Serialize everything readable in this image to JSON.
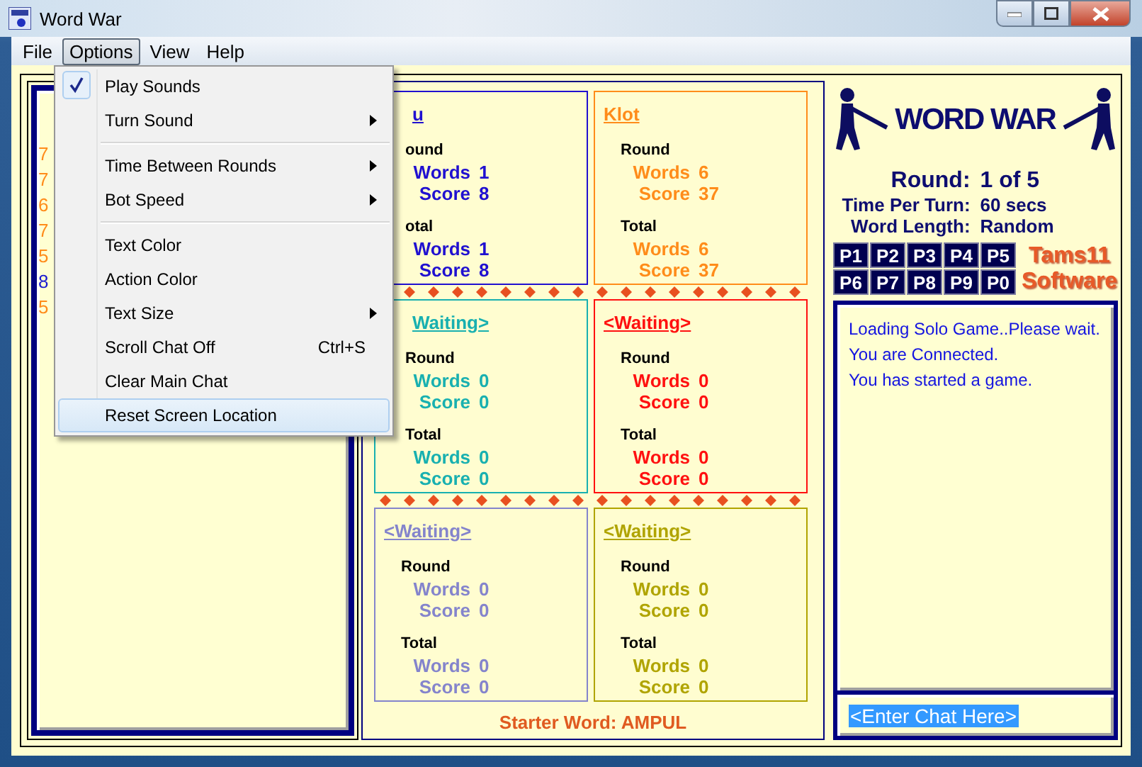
{
  "window": {
    "title": "Word War"
  },
  "menu_bar": [
    {
      "label": "File",
      "selected": false
    },
    {
      "label": "Options",
      "selected": true
    },
    {
      "label": "View",
      "selected": false
    },
    {
      "label": "Help",
      "selected": false
    }
  ],
  "options_menu": [
    {
      "kind": "item",
      "label": "Play Sounds",
      "checked": true,
      "submenu": false,
      "selected": false
    },
    {
      "kind": "item",
      "label": "Turn Sound",
      "checked": false,
      "submenu": true,
      "selected": false
    },
    {
      "kind": "separator"
    },
    {
      "kind": "item",
      "label": "Time Between Rounds",
      "checked": false,
      "submenu": true,
      "selected": false
    },
    {
      "kind": "item",
      "label": "Bot Speed",
      "checked": false,
      "submenu": true,
      "selected": false
    },
    {
      "kind": "separator"
    },
    {
      "kind": "item",
      "label": "Text Color",
      "checked": false,
      "submenu": false,
      "selected": false
    },
    {
      "kind": "item",
      "label": "Action Color",
      "checked": false,
      "submenu": false,
      "selected": false
    },
    {
      "kind": "item",
      "label": "Text Size",
      "checked": false,
      "submenu": true,
      "selected": false
    },
    {
      "kind": "item",
      "label": "Scroll Chat Off",
      "shortcut": "Ctrl+S",
      "checked": false,
      "submenu": false,
      "selected": false
    },
    {
      "kind": "item",
      "label": "Clear Main Chat",
      "checked": false,
      "submenu": false,
      "selected": false
    },
    {
      "kind": "item",
      "label": "Reset Screen Location",
      "checked": false,
      "submenu": false,
      "selected": true
    }
  ],
  "word_list": [
    {
      "text": "7",
      "color": "#ff8c1a"
    },
    {
      "text": "7",
      "color": "#ff8c1a"
    },
    {
      "text": "6",
      "color": "#ff8c1a"
    },
    {
      "text": "7",
      "color": "#ff8c1a"
    },
    {
      "text": "5",
      "color": "#ff8c1a"
    },
    {
      "text": "8",
      "color": "#1a1ad0"
    },
    {
      "text": "5",
      "color": "#ff8c1a"
    }
  ],
  "players": [
    {
      "name": "u",
      "covered": true,
      "color": "#2010d0",
      "round": {
        "label": "ound",
        "rows": [
          {
            "label": "Words",
            "value": "1"
          },
          {
            "label": "Score",
            "value": "8"
          }
        ]
      },
      "total": {
        "label": "otal",
        "rows": [
          {
            "label": "Words",
            "value": "1"
          },
          {
            "label": "Score",
            "value": "8"
          }
        ]
      }
    },
    {
      "name": "Klot",
      "covered": false,
      "color": "#ff8c1a",
      "round": {
        "label": "Round",
        "rows": [
          {
            "label": "Words",
            "value": "6"
          },
          {
            "label": "Score",
            "value": "37"
          }
        ]
      },
      "total": {
        "label": "Total",
        "rows": [
          {
            "label": "Words",
            "value": "6"
          },
          {
            "label": "Score",
            "value": "37"
          }
        ]
      }
    },
    {
      "name": "Waiting>",
      "covered": true,
      "color": "#18b0b0",
      "round": {
        "label": "Round",
        "rows": [
          {
            "label": "Words",
            "value": "0"
          },
          {
            "label": "Score",
            "value": "0"
          }
        ]
      },
      "total": {
        "label": "Total",
        "rows": [
          {
            "label": "Words",
            "value": "0"
          },
          {
            "label": "Score",
            "value": "0"
          }
        ]
      }
    },
    {
      "name": "<Waiting>",
      "covered": false,
      "color": "#ff1010",
      "round": {
        "label": "Round",
        "rows": [
          {
            "label": "Words",
            "value": "0"
          },
          {
            "label": "Score",
            "value": "0"
          }
        ]
      },
      "total": {
        "label": "Total",
        "rows": [
          {
            "label": "Words",
            "value": "0"
          },
          {
            "label": "Score",
            "value": "0"
          }
        ]
      }
    },
    {
      "name": "<Waiting>",
      "covered": false,
      "color": "#8484cc",
      "round": {
        "label": "Round",
        "rows": [
          {
            "label": "Words",
            "value": "0"
          },
          {
            "label": "Score",
            "value": "0"
          }
        ]
      },
      "total": {
        "label": "Total",
        "rows": [
          {
            "label": "Words",
            "value": "0"
          },
          {
            "label": "Score",
            "value": "0"
          }
        ]
      }
    },
    {
      "name": "<Waiting>",
      "covered": false,
      "color": "#b0a400",
      "round": {
        "label": "Round",
        "rows": [
          {
            "label": "Words",
            "value": "0"
          },
          {
            "label": "Score",
            "value": "0"
          }
        ]
      },
      "total": {
        "label": "Total",
        "rows": [
          {
            "label": "Words",
            "value": "0"
          },
          {
            "label": "Score",
            "value": "0"
          }
        ]
      }
    }
  ],
  "starter_word": "Starter Word: AMPUL",
  "logo_text": "WORD WAR",
  "game_info": [
    {
      "label": "Round:",
      "value": "1 of 5",
      "kind": "large"
    },
    {
      "label": "Time Per Turn:",
      "value": "60 secs",
      "kind": "normal"
    },
    {
      "label": "Word Length:",
      "value": "Random",
      "kind": "normal"
    }
  ],
  "player_buttons": [
    "P1",
    "P2",
    "P3",
    "P4",
    "P5",
    "P6",
    "P7",
    "P8",
    "P9",
    "P0"
  ],
  "brand": [
    "Tams11",
    "Software"
  ],
  "chat_log": [
    "Loading Solo Game..Please wait.",
    "You are Connected.",
    "You has started a game."
  ],
  "chat_input": {
    "value": "<Enter Chat Here>"
  }
}
